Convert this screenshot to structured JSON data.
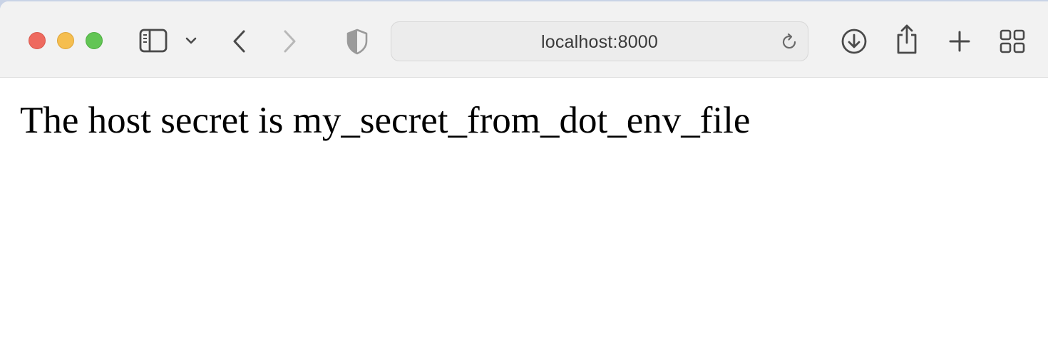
{
  "browser": {
    "url": "localhost:8000",
    "icons": {
      "sidebar": "sidebar-icon",
      "sidebar_menu": "chevron-down-icon",
      "back": "chevron-left-icon",
      "forward": "chevron-right-icon",
      "privacy": "shield-icon",
      "reload": "reload-icon",
      "download": "download-icon",
      "share": "share-icon",
      "new_tab": "plus-icon",
      "tab_overview": "grid-icon"
    },
    "colors": {
      "close": "#ee6a5f",
      "minimize": "#f5be4f",
      "maximize": "#62c554",
      "toolbar": "#f2f2f2",
      "icon": "#4a4a4a"
    }
  },
  "page": {
    "message": "The host secret is my_secret_from_dot_env_file"
  }
}
